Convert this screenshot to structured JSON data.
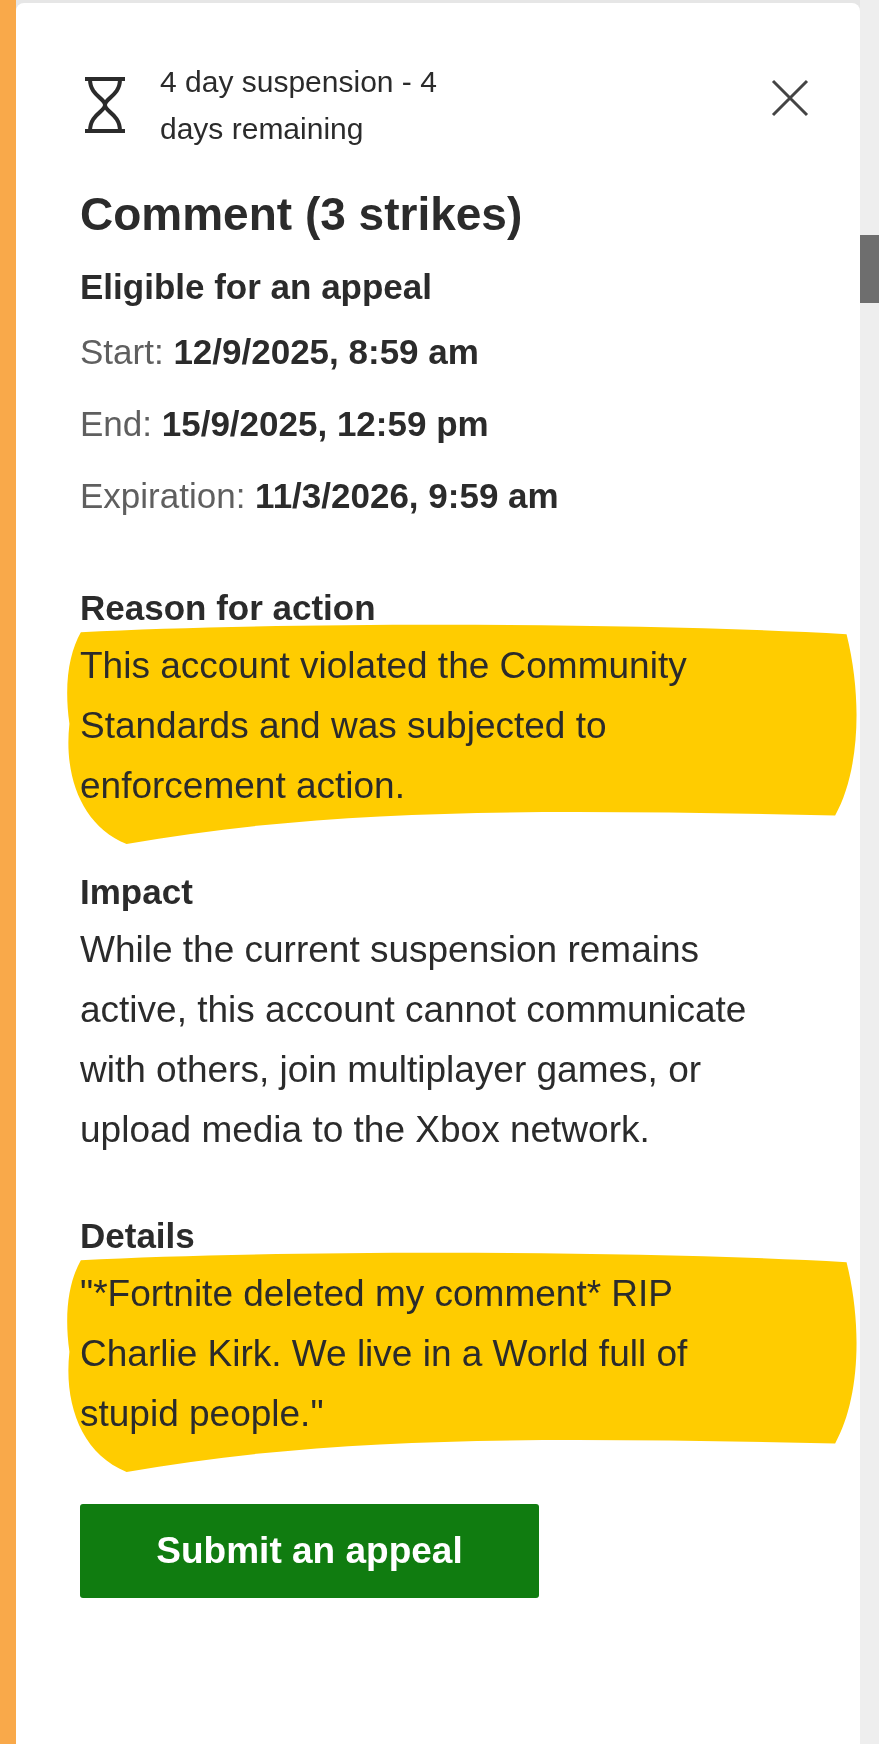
{
  "status": {
    "text": "4 day suspension - 4 days remaining"
  },
  "title": "Comment (3 strikes)",
  "eligibility": "Eligible for an appeal",
  "dates": [
    {
      "label": "Start:",
      "value": "12/9/2025, 8:59 am"
    },
    {
      "label": "End:",
      "value": "15/9/2025, 12:59 pm"
    },
    {
      "label": "Expiration:",
      "value": "11/3/2026, 9:59 am"
    }
  ],
  "sections": [
    {
      "heading": "Reason for action",
      "text": "This account violated the Community Standards and was subjected to enforcement action.",
      "highlighted": true
    },
    {
      "heading": "Impact",
      "text": "While the current suspension remains active, this account cannot communicate with others, join multiplayer games, or upload media to the Xbox network.",
      "highlighted": false
    },
    {
      "heading": "Details",
      "text": "\"*Fortnite deleted my comment* RIP Charlie Kirk. We live in a World full of stupid people.\"",
      "highlighted": true
    }
  ],
  "button": "Submit an appeal"
}
